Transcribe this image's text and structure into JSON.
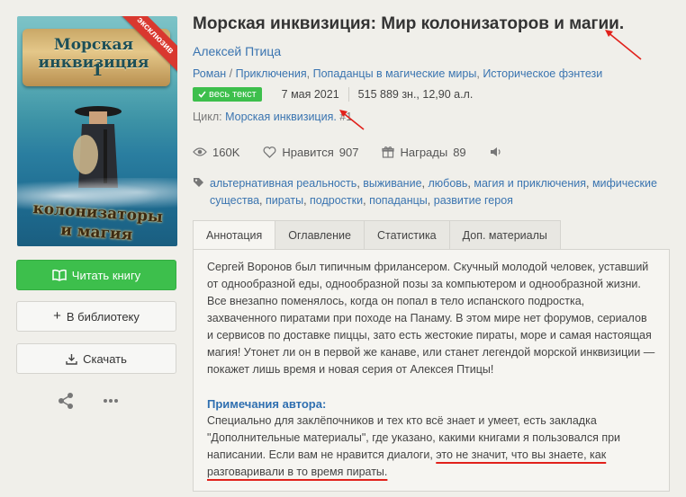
{
  "cover": {
    "title_top": "Морская инквизиция",
    "number": "1",
    "title_bottom_1": "колонизаторы",
    "title_bottom_2": "и магия",
    "ribbon": "эксклюзив"
  },
  "actions": {
    "read_label": "Читать книгу",
    "library_label": "В библиотеку",
    "download_label": "Скачать"
  },
  "book": {
    "title": "Морская инквизиция: Мир колонизаторов и магии.",
    "author": "Алексей Птица",
    "genres": [
      "Роман",
      "Приключения",
      "Попаданцы в магические миры",
      "Историческое фэнтези"
    ],
    "badge": "весь текст",
    "date": "7 мая 2021",
    "size": "515 889 зн., 12,90 а.л.",
    "cycle_label": "Цикл:",
    "cycle_name": "Морская инквизиция.",
    "cycle_num": "#1"
  },
  "stats": {
    "views": "160K",
    "likes_label": "Нравится",
    "likes": "907",
    "awards_label": "Награды",
    "awards": "89"
  },
  "tags": [
    "альтернативная реальность",
    "выживание",
    "любовь",
    "магия и приключения",
    "мифические существа",
    "пираты",
    "подростки",
    "попаданцы",
    "развитие героя"
  ],
  "tabs": [
    "Аннотация",
    "Оглавление",
    "Статистика",
    "Доп. материалы"
  ],
  "annotation": {
    "text": "Сергей Воронов был типичным фрилансером. Скучный молодой человек, уставший от однообразной еды, однообразной позы за компьютером и однообразной жизни. Все внезапно поменялось, когда он попал в тело испанского подростка, захваченного пиратами при походе на Панаму. В этом мире нет форумов, сериалов и сервисов по доставке пиццы, зато есть жестокие пираты, море и самая настоящая магия! Утонет ли он в первой же канаве, или станет легендой морской инквизиции — покажет лишь время и новая серия от Алексея Птицы!",
    "notes_title": "Примечания автора:",
    "notes_1": "Специально для заклёпочников и тех кто всё знает и умеет, есть закладка \"Дополнительные материалы\", где указано, какими книгами я пользовался при написании. Если вам не нравится диалоги, ",
    "notes_2": "это не значит, что вы знаете, как разговаривали в то время пираты."
  },
  "colors": {
    "accent_green": "#3dbf4c",
    "link_blue": "#3a74b0",
    "annotation_red": "#e1211b",
    "background": "#f0efea"
  }
}
